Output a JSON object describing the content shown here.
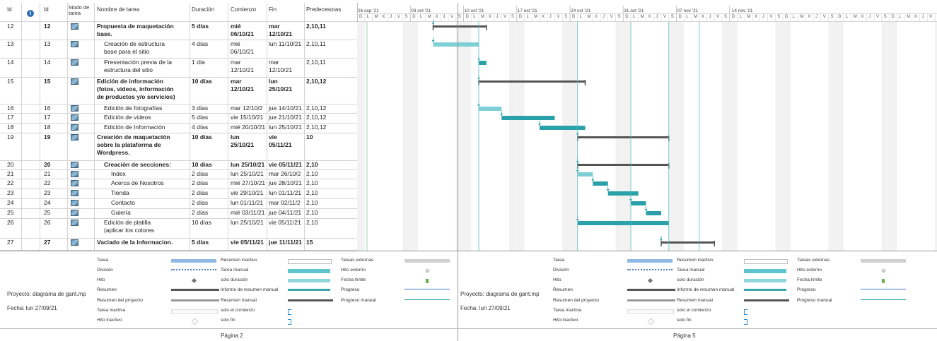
{
  "headers": {
    "id": "Id",
    "info_icon": "info-icon",
    "id2": "Id",
    "mode": "Modo de\ntarea",
    "name": "Nombre de tarea",
    "duration": "Duración",
    "start": "Comienzo",
    "end": "Fin",
    "pred": "Predecesoras"
  },
  "rows": [
    {
      "id": "12",
      "id2": "12",
      "name": "Propuesta de maquetación\nbase.",
      "dur": "5 días",
      "start": "mié\n06/10/21",
      "end": "mar\n12/10/21",
      "pred": "2,10,11",
      "bold": true
    },
    {
      "id": "13",
      "id2": "13",
      "name": "Creación de estructura\nbase para el sitio",
      "dur": "4 días",
      "start": "mié\n06/10/21",
      "end": "lun 11/10/21",
      "pred": "2,10,11",
      "bold": false
    },
    {
      "id": "14",
      "id2": "14",
      "name": "Presentación previa de la\nestructura del sitio",
      "dur": "1 día",
      "start": "mar\n12/10/21",
      "end": "mar\n12/10/21",
      "pred": "2,10,11",
      "bold": false
    },
    {
      "id": "15",
      "id2": "15",
      "name": "Edición de información\n(fotos, videos, información\nde productos y/o servicios)",
      "dur": "10 días",
      "start": "mar\n12/10/21",
      "end": "lun\n25/10/21",
      "pred": "2,10,12",
      "bold": true
    },
    {
      "id": "16",
      "id2": "16",
      "name": "Edición de fotografías",
      "dur": "3 días",
      "start": "mar 12/10/2",
      "end": "jue 14/10/21",
      "pred": "2,10,12",
      "bold": false
    },
    {
      "id": "17",
      "id2": "17",
      "name": "Edición de videos",
      "dur": "5 días",
      "start": "vie 15/10/21",
      "end": "jue 21/10/21",
      "pred": "2,10,12",
      "bold": false
    },
    {
      "id": "18",
      "id2": "18",
      "name": "Edición de Información",
      "dur": "4 días",
      "start": "mié 20/10/21",
      "end": "lun 25/10/21",
      "pred": "2,10,12",
      "bold": false
    },
    {
      "id": "19",
      "id2": "19",
      "name": "Creación de maquetación\nsobre la plataforma de\nWordpress.",
      "dur": "10 días",
      "start": "lun\n25/10/21",
      "end": "vie\n05/11/21",
      "pred": "10",
      "bold": true
    },
    {
      "id": "20",
      "id2": "20",
      "name": "Creación de secciones:",
      "dur": "10 días",
      "start": "lun 25/10/21",
      "end": "vie 05/11/21",
      "pred": "2,10",
      "bold": true
    },
    {
      "id": "21",
      "id2": "21",
      "name": "Index",
      "dur": "2 días",
      "start": "lun 25/10/21",
      "end": "mar 26/10/2",
      "pred": "2,10",
      "bold": false
    },
    {
      "id": "22",
      "id2": "22",
      "name": "Acerca de Nosotros",
      "dur": "2 días",
      "start": "mié 27/10/21",
      "end": "jue 28/10/21",
      "pred": "2,10",
      "bold": false
    },
    {
      "id": "23",
      "id2": "23",
      "name": "Tienda",
      "dur": "2 días",
      "start": "vie 29/10/21",
      "end": "lun 01/11/21",
      "pred": "2,10",
      "bold": false
    },
    {
      "id": "24",
      "id2": "24",
      "name": "Contacto",
      "dur": "2 días",
      "start": "lun 01/11/21",
      "end": "mar 02/11/2",
      "pred": "2,10",
      "bold": false
    },
    {
      "id": "25",
      "id2": "25",
      "name": "Galería",
      "dur": "2 días",
      "start": "mié 03/11/21",
      "end": "jue 04/11/21",
      "pred": "2,10",
      "bold": false
    },
    {
      "id": "26",
      "id2": "26",
      "name": "Edición de platilla\n(aplicar los colores",
      "dur": "10 días",
      "start": "lun 25/10/21",
      "end": "vie 05/11/21",
      "pred": "2,10",
      "bold": false
    },
    {
      "id": "27",
      "id2": "27",
      "name": "Vaciado de la informacion.",
      "dur": "5 días",
      "start": "vie 05/11/21",
      "end": "jue 11/11/21",
      "pred": "15",
      "bold": true
    }
  ],
  "weeks": [
    "26 sep '21",
    "03 oct '21",
    "10 oct '21",
    "17 oct '21",
    "24 oct '21",
    "31 oct '21",
    "07 nov '21",
    "14 nov '21"
  ],
  "day_letters": [
    "D",
    "L",
    "M",
    "X",
    "J",
    "V",
    "S"
  ],
  "legend": {
    "col1": [
      "Tarea",
      "División",
      "Hito",
      "Resumen",
      "Resumen del proyecto",
      "Tarea inactiva",
      "Hito inactivo"
    ],
    "col2": [
      "Resumen inactivo",
      "Tarea manual",
      "solo duración",
      "Informe de resumen manual",
      "Resumen manual",
      "solo el comienzo",
      "solo fin"
    ],
    "col3": [
      "Tareas externas",
      "Hito externo",
      "Fecha límite",
      "Progreso",
      "Progreso manual"
    ]
  },
  "project": {
    "name": "Proyecto: diagrama de gant.mp",
    "date": "Fecha: lun 27/09/21"
  },
  "pages": {
    "left": "Página 2",
    "right": "Página 5"
  },
  "colors": {
    "task": "#2aa0a8",
    "task_light": "#7fd0d6",
    "summary": "#555555",
    "grid": "#d4d4d4",
    "weekend": "#f2f2f2",
    "milestone_line": "#5bbcc4",
    "progress": "#3f6fcf",
    "today_line": "#9ad29a"
  }
}
